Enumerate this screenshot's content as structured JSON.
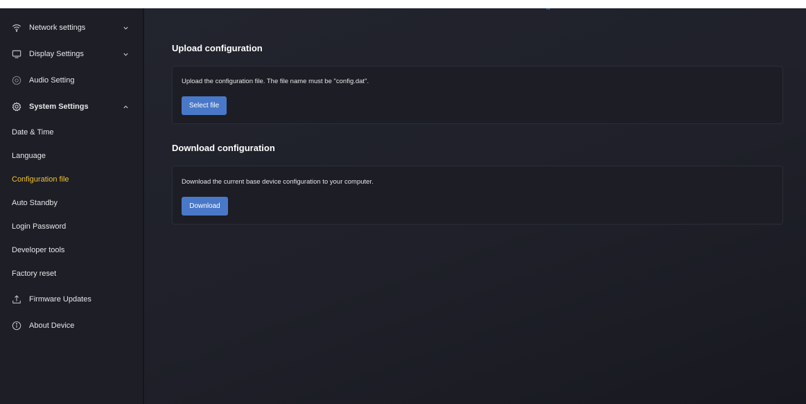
{
  "sidebar": {
    "items": [
      {
        "label": "Network settings",
        "icon": "wifi-icon",
        "chevron": "down"
      },
      {
        "label": "Display Settings",
        "icon": "monitor-icon",
        "chevron": "down"
      },
      {
        "label": "Audio Setting",
        "icon": "speaker-icon"
      },
      {
        "label": "System Settings",
        "icon": "gear-icon",
        "chevron": "up"
      }
    ],
    "sub_items": [
      {
        "label": "Date & Time"
      },
      {
        "label": "Language"
      },
      {
        "label": "Configuration file",
        "active": true
      },
      {
        "label": "Auto Standby"
      },
      {
        "label": "Login Password"
      },
      {
        "label": "Developer tools"
      },
      {
        "label": "Factory reset"
      }
    ],
    "bottom_items": [
      {
        "label": "Firmware Updates",
        "icon": "upload-icon"
      },
      {
        "label": "About Device",
        "icon": "info-icon"
      }
    ]
  },
  "upload": {
    "title": "Upload configuration",
    "description": "Upload the configuration file. The file name must be \"config.dat\".",
    "button_label": "Select file"
  },
  "download": {
    "title": "Download configuration",
    "description": "Download the current base device configuration to your computer.",
    "button_label": "Download"
  },
  "colors": {
    "accent": "#f1c232",
    "button": "#4a78c8",
    "background": "#1f2029"
  }
}
